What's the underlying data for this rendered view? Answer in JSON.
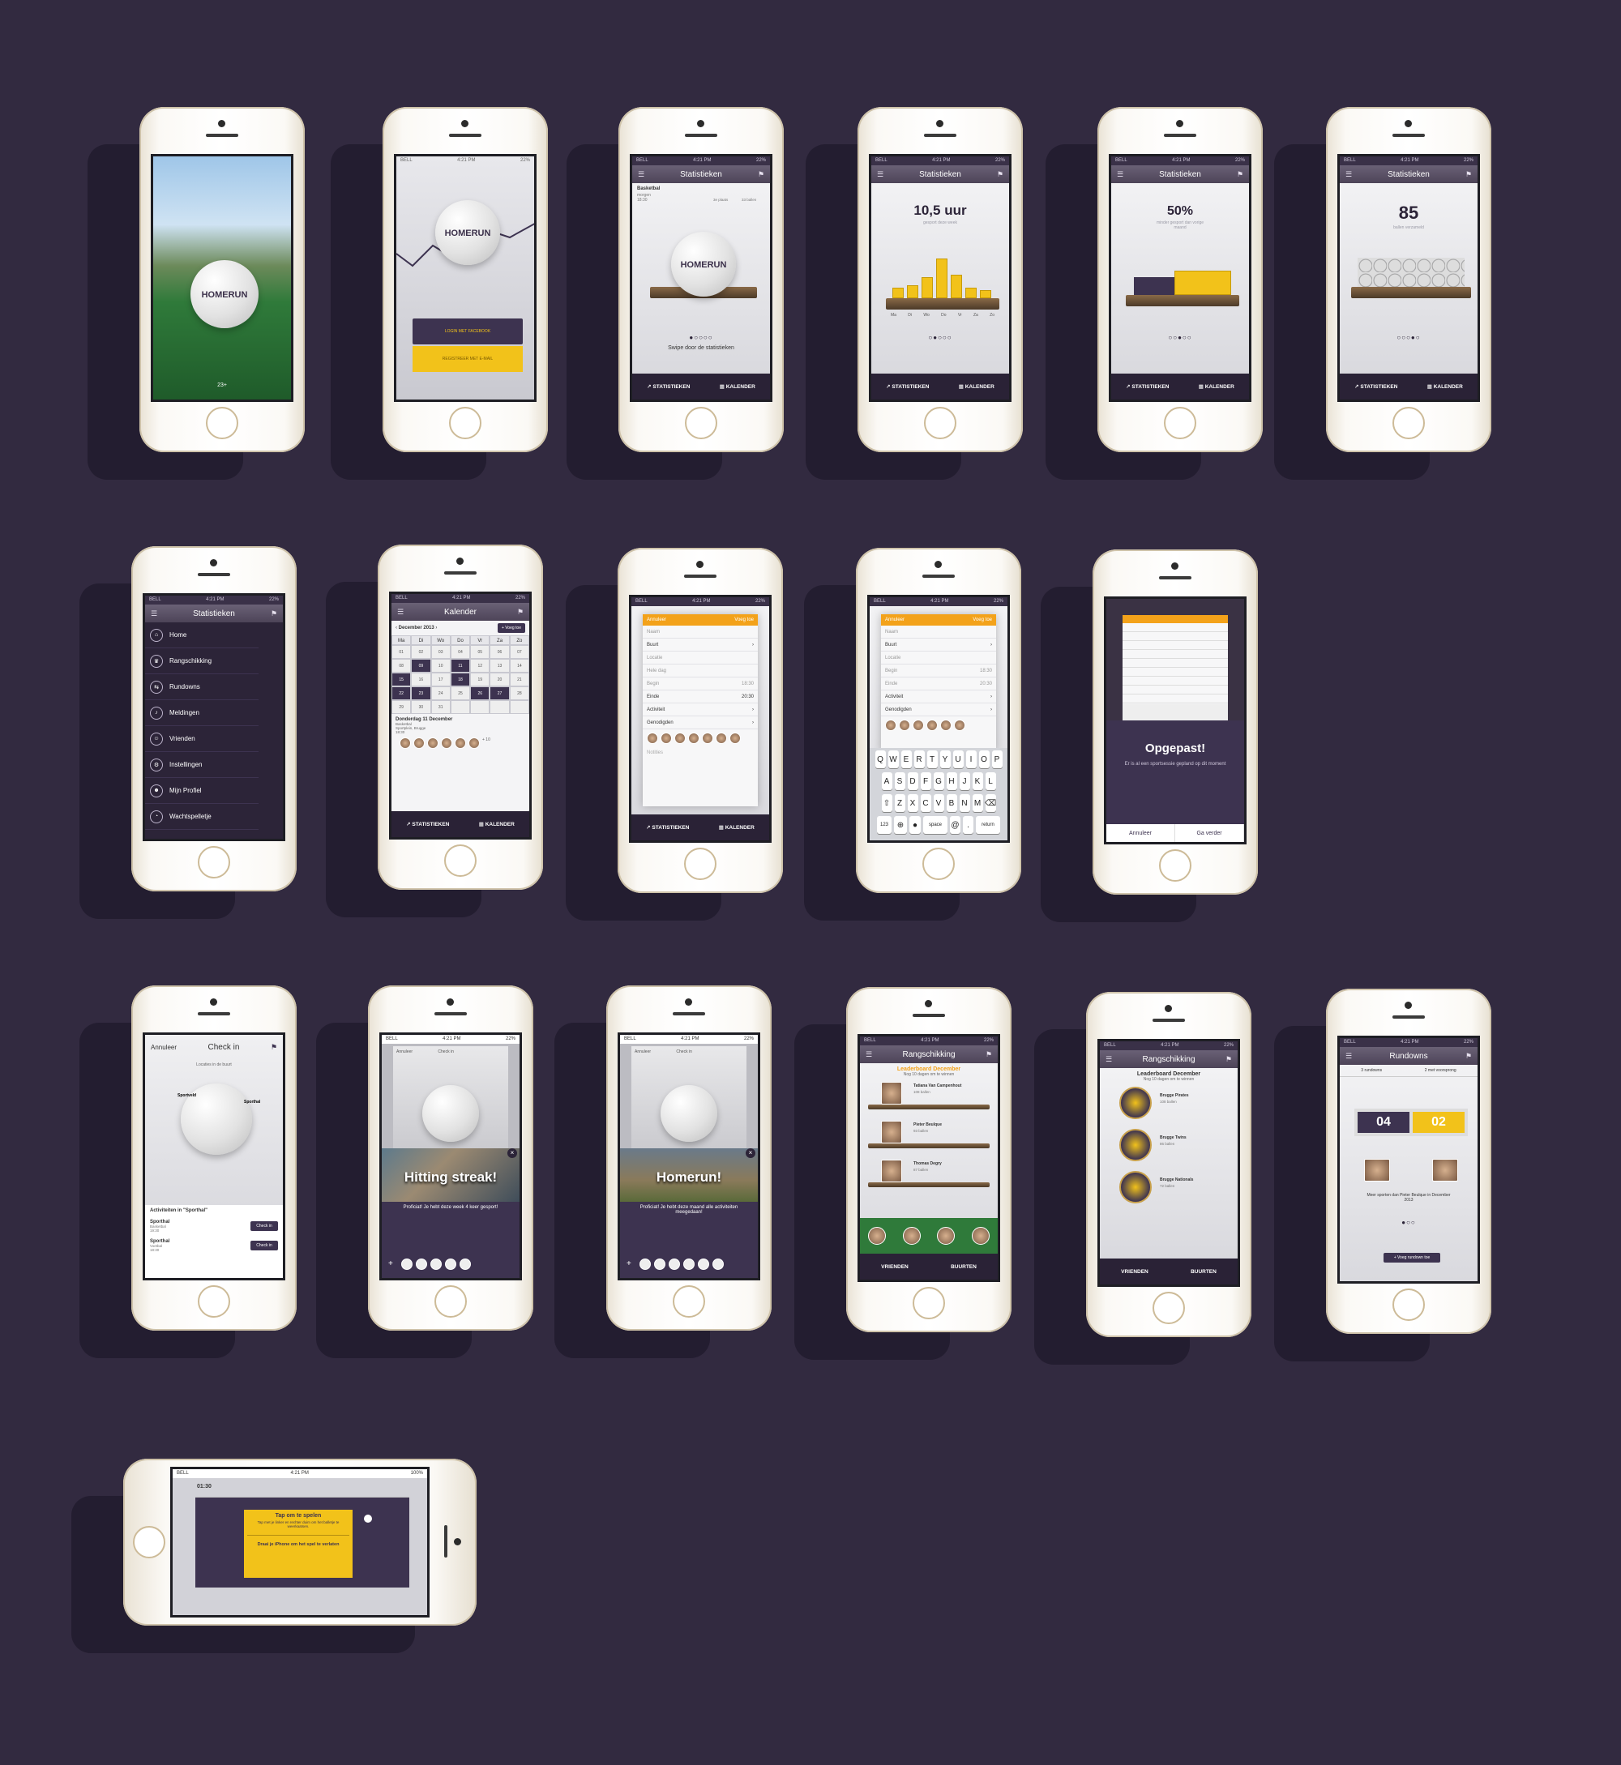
{
  "colors": {
    "background": "#322a40",
    "accent": "#f2c21a",
    "purple": "#3d3350",
    "orange": "#f3a21a"
  },
  "status": {
    "carrier": "BELL",
    "time": "4:21 PM",
    "battery": "22%",
    "battery_full": "100%"
  },
  "tabs": {
    "stats": "STATISTIEKEN",
    "calendar": "KALENDER",
    "friends": "VRIENDEN",
    "neighbours": "BUURTEN"
  },
  "p1": {
    "logo": "HOMERUN",
    "counter": "23+"
  },
  "p2": {
    "logo": "HOMERUN",
    "login_fb": "LOGIN MET FACEBOOK",
    "register": "REGISTREER MET E-MAIL"
  },
  "p3": {
    "title": "Statistieken",
    "sport": "Basketbal",
    "when": "morgen",
    "time": "18:30",
    "stat1": "3e plaats",
    "stat2": "33 ballen",
    "logo": "HOMERUN",
    "swipe": "Swipe door de statistieken",
    "dots": "●○○○○"
  },
  "p4": {
    "title": "Statistieken",
    "value": "10,5 uur",
    "sub": "gesport deze week",
    "days": [
      "Ma",
      "Di",
      "Wo",
      "Do",
      "Vr",
      "Za",
      "Zo"
    ],
    "bars": [
      0.25,
      0.3,
      0.5,
      0.95,
      0.55,
      0.25,
      0.2
    ],
    "dots": "○●○○○"
  },
  "p5": {
    "title": "Statistieken",
    "value": "50%",
    "sub": "minder gesport dan vorige maand",
    "dots": "○○●○○"
  },
  "p6": {
    "title": "Statistieken",
    "value": "85",
    "sub": "ballen verzameld",
    "dots": "○○○●○"
  },
  "p7": {
    "title": "Statistieken",
    "menu": [
      "Home",
      "Rangschikking",
      "Rundowns",
      "Meldingen",
      "Vrienden",
      "Instellingen",
      "Mijn Profiel",
      "Wachtspelletje"
    ]
  },
  "p8": {
    "title": "Kalender",
    "month": "December 2013",
    "add": "+ Voeg toe",
    "weekdays": [
      "Ma",
      "Di",
      "Wo",
      "Do",
      "Vr",
      "Za",
      "Zo"
    ],
    "days": [
      "01",
      "02",
      "03",
      "04",
      "05",
      "06",
      "07",
      "08",
      "09",
      "10",
      "11",
      "12",
      "13",
      "14",
      "15",
      "16",
      "17",
      "18",
      "19",
      "20",
      "21",
      "22",
      "23",
      "24",
      "25",
      "26",
      "27",
      "28",
      "29",
      "30",
      "31",
      "",
      "",
      "",
      ""
    ],
    "event_date": "Donderdag 11 December",
    "event_sport": "Basketbal",
    "event_place": "Gemeentehal",
    "event_city": "Sportplein, Brugge",
    "event_time": "18:30",
    "more": "+ 10"
  },
  "p9": {
    "cancel": "Annuleer",
    "title": "Kalender",
    "add": "Voeg toe",
    "rows": [
      "Naam",
      "Buurt",
      "Locatie",
      "Hele dag",
      "Begin",
      "Einde",
      "Activiteit",
      "Genodigden"
    ],
    "begin": "18:30",
    "end": "20:30",
    "notes": "Notities"
  },
  "p10": {
    "cancel": "Annuleer",
    "add": "Voeg toe",
    "rows": [
      "Naam",
      "Buurt",
      "Locatie",
      "Begin",
      "Einde",
      "Activiteit",
      "Genodigden"
    ],
    "begin": "18:30",
    "end": "20:30",
    "keys1": [
      "Q",
      "W",
      "E",
      "R",
      "T",
      "Y",
      "U",
      "I",
      "O",
      "P"
    ],
    "keys2": [
      "A",
      "S",
      "D",
      "F",
      "G",
      "H",
      "J",
      "K",
      "L"
    ],
    "keys3": [
      "Z",
      "X",
      "C",
      "V",
      "B",
      "N",
      "M"
    ],
    "k123": "123",
    "space": "space",
    "at": "@",
    "dot": ".",
    "ret": "return"
  },
  "p11": {
    "title": "Opgepast!",
    "text": "Er is al een sportsessie gepland op dit moment",
    "cancel": "Annuleer",
    "go": "Ga verder"
  },
  "p12": {
    "cancel": "Annuleer",
    "title": "Check in",
    "hint": "Locaties in de buurt",
    "loc1": "Sportveld",
    "loc2": "Sporthal",
    "section": "Activiteiten in \"Sporthal\"",
    "items": [
      {
        "name": "Sporthal",
        "sport": "Basketbal",
        "time": "19:30"
      },
      {
        "name": "Sporthal",
        "sport": "Voetbal",
        "time": "18:30"
      }
    ],
    "btn": "Check in"
  },
  "p13": {
    "cancel": "Annuleer",
    "title": "Check in",
    "headline": "Hitting streak!",
    "text": "Proficiat! Je hebt deze week 4 keer gesport!"
  },
  "p14": {
    "cancel": "Annuleer",
    "title": "Check in",
    "headline": "Homerun!",
    "text": "Proficiat! Je hebt deze maand alle activiteiten meegedaan!"
  },
  "p15": {
    "title": "Rangschikking",
    "board": "Leaderboard December",
    "sub": "Nog 10 dagen om te winnen",
    "people": [
      {
        "name": "Tatiana Van Campenhout",
        "balls": "108 ballen"
      },
      {
        "name": "Pieter Beulque",
        "balls": "93 ballen"
      },
      {
        "name": "Thomas Degry",
        "balls": "87 ballen"
      }
    ]
  },
  "p16": {
    "title": "Rangschikking",
    "board": "Leaderboard December",
    "sub": "Nog 10 dagen om te winnen",
    "teams": [
      {
        "name": "Brugge Pirates",
        "balls": "108 ballen"
      },
      {
        "name": "Brugge Twins",
        "balls": "86 ballen"
      },
      {
        "name": "Brugge Nationals",
        "balls": "72 ballen"
      }
    ],
    "logo3": "NATIONALS"
  },
  "p17": {
    "title": "Rundowns",
    "tab1": "3 rundowns",
    "tab2": "2 met voorsprong",
    "score1": "04",
    "score2": "02",
    "text": "Meer sporten dan Pieter Beulque in December 2013",
    "add": "+ Voeg rundown toe",
    "dots": "●○○"
  },
  "p18": {
    "time": "01:30",
    "tap": "Tap om te spelen",
    "tap_sub": "Tap met je linker en rechter duim om het balletje te weerkaatsen.",
    "rotate": "Draai je iPhone om het spel te verlaten"
  }
}
